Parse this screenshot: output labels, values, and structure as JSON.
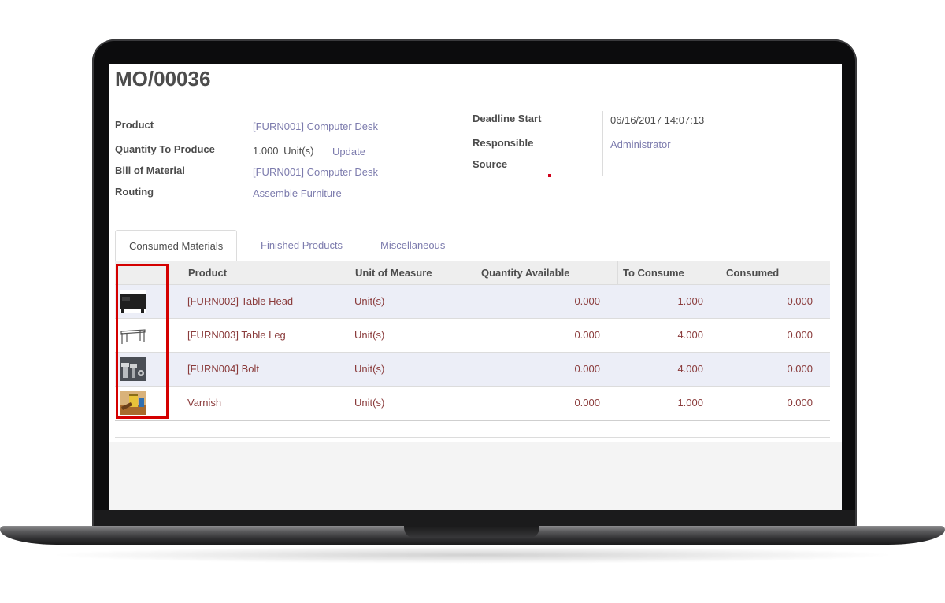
{
  "record": {
    "title": "MO/00036"
  },
  "fields_left": {
    "product": {
      "label": "Product",
      "value": "[FURN001] Computer Desk"
    },
    "quantity": {
      "label": "Quantity To Produce",
      "value": "1.000",
      "uom": "Unit(s)",
      "update_label": "Update"
    },
    "bom": {
      "label": "Bill of Material",
      "value": "[FURN001] Computer Desk"
    },
    "routing": {
      "label": "Routing",
      "value": "Assemble Furniture"
    }
  },
  "fields_right": {
    "deadline": {
      "label": "Deadline Start",
      "value": "06/16/2017 14:07:13"
    },
    "responsible": {
      "label": "Responsible",
      "value": "Administrator"
    },
    "source": {
      "label": "Source",
      "value": ""
    }
  },
  "tabs": [
    {
      "label": "Consumed Materials",
      "active": true
    },
    {
      "label": "Finished Products",
      "active": false
    },
    {
      "label": "Miscellaneous",
      "active": false
    }
  ],
  "table": {
    "columns": [
      "",
      "Product",
      "Unit of Measure",
      "Quantity Available",
      "To Consume",
      "Consumed"
    ],
    "rows": [
      {
        "image": "table-head-thumbnail",
        "product": "[FURN002] Table Head",
        "uom": "Unit(s)",
        "available": "0.000",
        "to_consume": "1.000",
        "consumed": "0.000"
      },
      {
        "image": "table-leg-thumbnail",
        "product": "[FURN003] Table Leg",
        "uom": "Unit(s)",
        "available": "0.000",
        "to_consume": "4.000",
        "consumed": "0.000"
      },
      {
        "image": "bolt-thumbnail",
        "product": "[FURN004] Bolt",
        "uom": "Unit(s)",
        "available": "0.000",
        "to_consume": "4.000",
        "consumed": "0.000"
      },
      {
        "image": "varnish-thumbnail",
        "product": "Varnish",
        "uom": "Unit(s)",
        "available": "0.000",
        "to_consume": "1.000",
        "consumed": "0.000"
      }
    ]
  },
  "colors": {
    "link": "#7c7bad",
    "row_text": "#8a3b3b",
    "highlight": "#d40000",
    "label": "#4c4c4c"
  }
}
